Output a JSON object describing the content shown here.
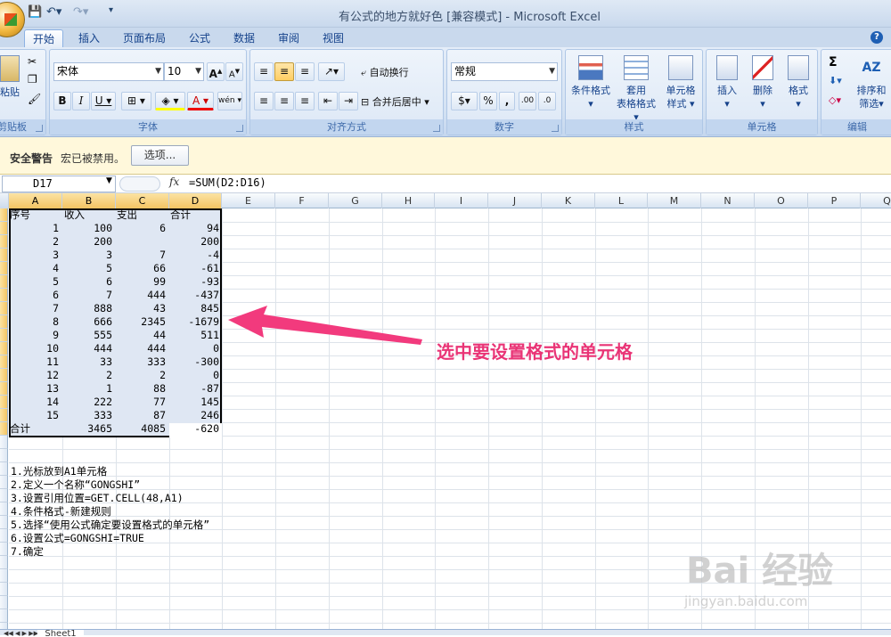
{
  "window": {
    "title": "有公式的地方就好色 [兼容模式] - Microsoft Excel"
  },
  "tabs": [
    "开始",
    "插入",
    "页面布局",
    "公式",
    "数据",
    "审阅",
    "视图"
  ],
  "ribbon": {
    "paste": "粘贴",
    "clipboard": "剪贴板",
    "font_name": "宋体",
    "font_size": "10",
    "font_group": "字体",
    "wrap_text": "自动换行",
    "merge_center": "合并后居中",
    "align_group": "对齐方式",
    "number_format": "常规",
    "number_group": "数字",
    "percent": "%",
    "comma": ",",
    "cond_format": "条件格式",
    "table_format_1": "套用",
    "table_format_2": "表格格式",
    "cell_style_1": "单元格",
    "cell_style_2": "样式",
    "style_group": "样式",
    "insert": "插入",
    "delete": "删除",
    "format": "格式",
    "cells_group": "单元格",
    "sort_filter_1": "排序和",
    "sort_filter_2": "筛选",
    "edit_group": "编辑",
    "sum_icon": "Σ",
    "sort_icon": "AZ"
  },
  "security": {
    "title": "安全警告",
    "message": "宏已被禁用。",
    "options": "选项..."
  },
  "formula_bar": {
    "name_box": "D17",
    "fx": "fx",
    "formula": "=SUM(D2:D16)"
  },
  "columns": [
    "A",
    "B",
    "C",
    "D",
    "E",
    "F",
    "G",
    "H",
    "I",
    "J",
    "K",
    "L",
    "M",
    "N",
    "O",
    "P",
    "Q"
  ],
  "table": {
    "headers": [
      "序号",
      "收入",
      "支出",
      "合计"
    ],
    "rows": [
      [
        "1",
        "100",
        "6",
        "94"
      ],
      [
        "2",
        "200",
        "",
        "200"
      ],
      [
        "3",
        "3",
        "7",
        "-4"
      ],
      [
        "4",
        "5",
        "66",
        "-61"
      ],
      [
        "5",
        "6",
        "99",
        "-93"
      ],
      [
        "6",
        "7",
        "444",
        "-437"
      ],
      [
        "7",
        "888",
        "43",
        "845"
      ],
      [
        "8",
        "666",
        "2345",
        "-1679"
      ],
      [
        "9",
        "555",
        "44",
        "511"
      ],
      [
        "10",
        "444",
        "444",
        "0"
      ],
      [
        "11",
        "33",
        "333",
        "-300"
      ],
      [
        "12",
        "2",
        "2",
        "0"
      ],
      [
        "13",
        "1",
        "88",
        "-87"
      ],
      [
        "14",
        "222",
        "77",
        "145"
      ],
      [
        "15",
        "333",
        "87",
        "246"
      ]
    ],
    "total_label": "合计",
    "totals": [
      "3465",
      "4085",
      "-620"
    ]
  },
  "notes": [
    "1.光标放到A1单元格",
    "2.定义一个名称“GONGSHI”",
    "3.设置引用位置=GET.CELL(48,A1)",
    "4.条件格式-新建规则",
    "5.选择“使用公式确定要设置格式的单元格”",
    "6.设置公式=GONGSHI=TRUE",
    "7.确定"
  ],
  "annotation": "选中要设置格式的单元格",
  "sheet_tab": "Sheet1",
  "watermark": {
    "main": "Bai 经验",
    "sub": "jingyan.baidu.com"
  },
  "colors": {
    "annotation": "#e93476",
    "selection": "#dfe7f3",
    "ribbon": "#d4e2f3"
  }
}
